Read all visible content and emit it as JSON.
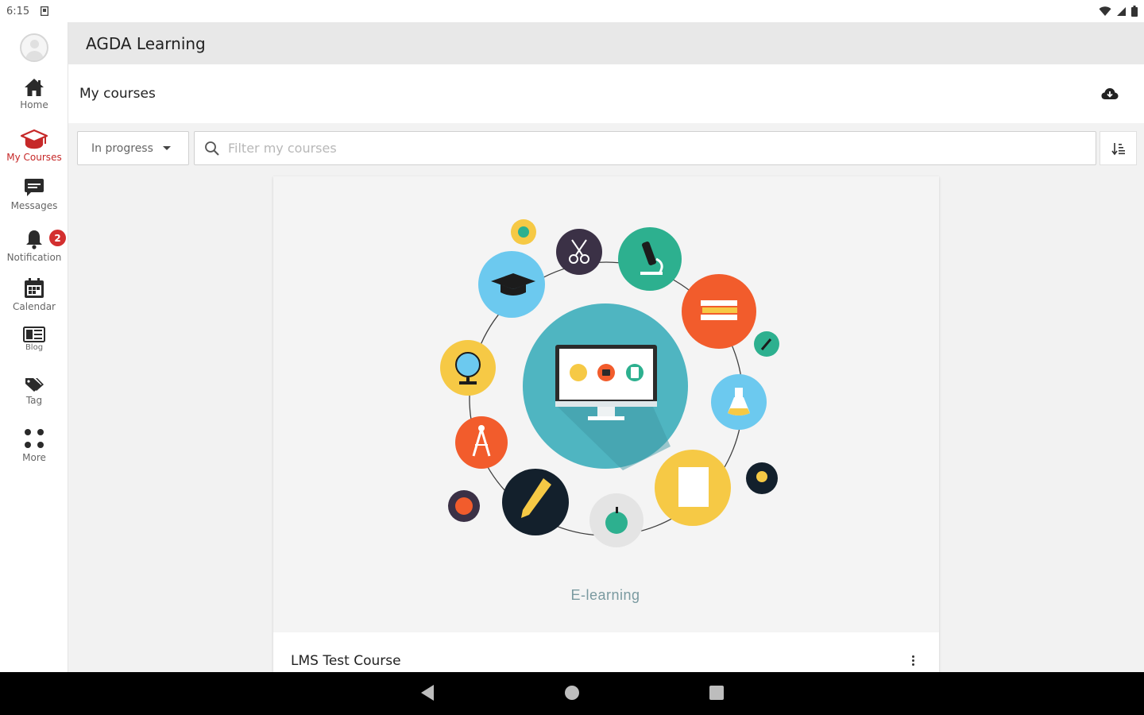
{
  "status_bar": {
    "time": "6:15",
    "icons": [
      "sim-card-icon",
      "wifi-icon",
      "signal-icon",
      "battery-icon"
    ]
  },
  "app": {
    "title": "AGDA Learning"
  },
  "sidebar": {
    "items": [
      {
        "label": "Home",
        "icon": "home-icon",
        "active": false
      },
      {
        "label": "My Courses",
        "icon": "graduation-cap-icon",
        "active": true
      },
      {
        "label": "Messages",
        "icon": "chat-icon",
        "active": false
      },
      {
        "label": "Notification",
        "icon": "bell-icon",
        "active": false,
        "badge": "2"
      },
      {
        "label": "Calendar",
        "icon": "calendar-icon",
        "active": false
      },
      {
        "label": "Blog",
        "icon": "blog-icon",
        "active": false
      },
      {
        "label": "Tag",
        "icon": "tag-icon",
        "active": false
      },
      {
        "label": "More",
        "icon": "grid-dots-icon",
        "active": false
      }
    ]
  },
  "page": {
    "title": "My courses",
    "download_icon": "cloud-download-icon"
  },
  "filters": {
    "status_selected": "In progress",
    "search_placeholder": "Filter my courses",
    "search_value": "",
    "sort_icon": "sort-icon"
  },
  "course_card": {
    "image_caption": "E-learning",
    "name": "LMS Test Course",
    "menu_icon": "more-vertical-icon"
  },
  "colors": {
    "accent": "#c62828",
    "teal": "#4fb5c1",
    "orange": "#f25c2c",
    "yellow": "#f6c945",
    "light_blue": "#6cc9ef",
    "green": "#2db08f",
    "dark_navy": "#13202c",
    "purple_dark": "#3b3146"
  },
  "system_nav": {
    "buttons": [
      "back-icon",
      "home-circle-icon",
      "recents-icon"
    ]
  }
}
